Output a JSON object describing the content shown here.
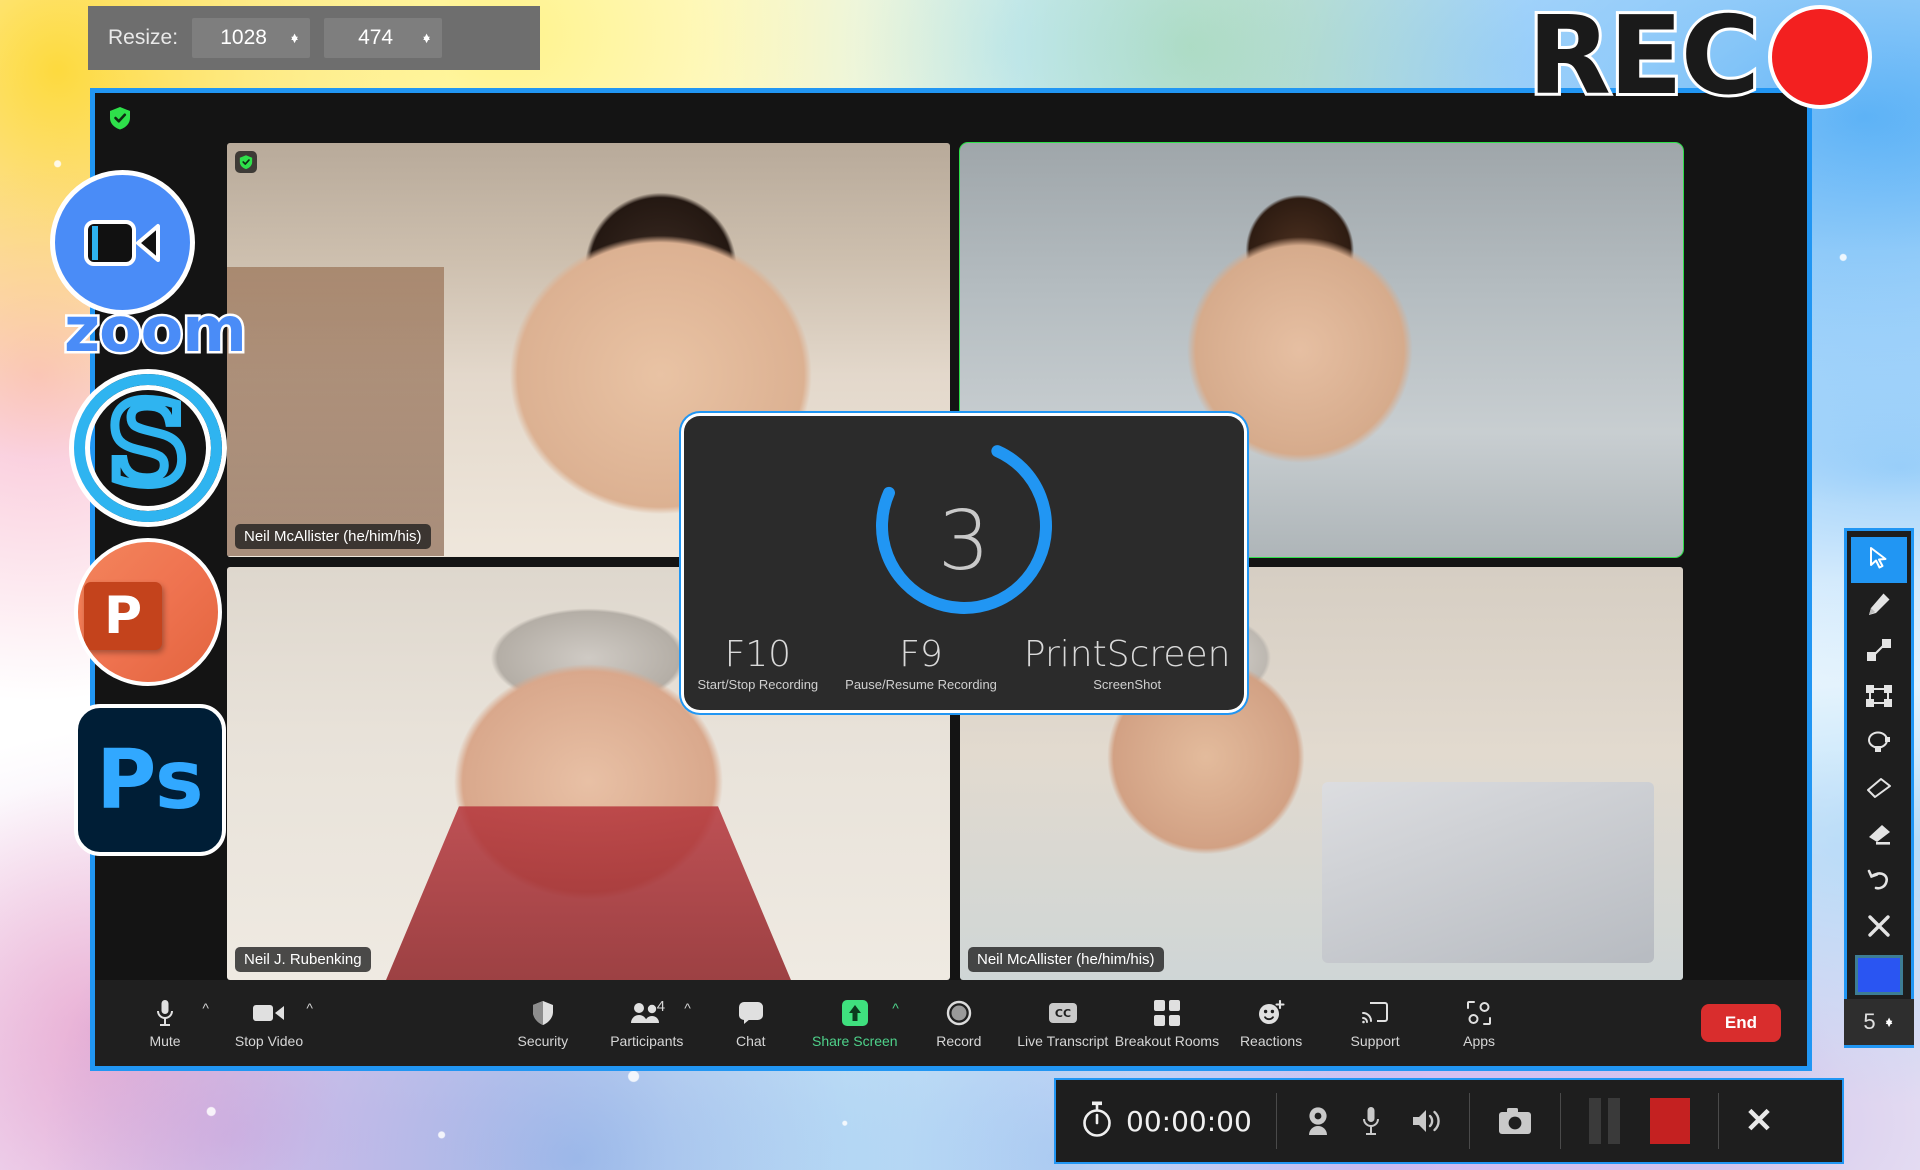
{
  "resize_bar": {
    "label": "Resize:",
    "width_value": "1028",
    "height_value": "474",
    "stepper_up": "▲",
    "stepper_down": "▼"
  },
  "rec_overlay": {
    "text": "REC",
    "dot_color": "#f32020"
  },
  "app_rail": {
    "items": [
      {
        "name": "zoom",
        "label": "zoom"
      },
      {
        "name": "skype",
        "label": "S"
      },
      {
        "name": "powerpoint",
        "label": "P"
      },
      {
        "name": "photoshop",
        "label": "Ps"
      }
    ]
  },
  "meeting": {
    "participants": [
      {
        "name": "Neil McAllister (he/him/his)",
        "active": false,
        "shield": true
      },
      {
        "name": "",
        "active": true,
        "shield": false
      },
      {
        "name": "Neil J. Rubenking",
        "active": false,
        "shield": false
      },
      {
        "name": "Neil McAllister (he/him/his)",
        "active": false,
        "shield": false
      }
    ],
    "toolbar": {
      "left": [
        {
          "id": "mute",
          "label": "Mute",
          "icon": "microphone-icon",
          "caret": true
        },
        {
          "id": "stop-video",
          "label": "Stop Video",
          "icon": "video-camera-icon",
          "caret": true
        }
      ],
      "middle": [
        {
          "id": "security",
          "label": "Security",
          "icon": "shield-icon",
          "caret": false
        },
        {
          "id": "participants",
          "label": "Participants",
          "icon": "people-icon",
          "caret": true,
          "count": "4"
        },
        {
          "id": "chat",
          "label": "Chat",
          "icon": "chat-bubble-icon",
          "caret": false
        },
        {
          "id": "share-screen",
          "label": "Share Screen",
          "icon": "share-up-arrow-icon",
          "caret": true,
          "highlight": true
        },
        {
          "id": "record",
          "label": "Record",
          "icon": "record-circle-icon",
          "caret": false
        },
        {
          "id": "live-transcript",
          "label": "Live Transcript",
          "icon": "closed-caption-icon",
          "caret": false
        },
        {
          "id": "breakout-rooms",
          "label": "Breakout Rooms",
          "icon": "grid-squares-icon",
          "caret": false
        },
        {
          "id": "reactions",
          "label": "Reactions",
          "icon": "smiley-plus-icon",
          "caret": false
        },
        {
          "id": "support",
          "label": "Support",
          "icon": "screen-cast-icon",
          "caret": false
        },
        {
          "id": "apps",
          "label": "Apps",
          "icon": "apps-icon",
          "caret": false
        }
      ],
      "end_button": "End"
    }
  },
  "countdown": {
    "number": "3",
    "hotkeys": [
      {
        "key": "F10",
        "desc": "Start/Stop Recording"
      },
      {
        "key": "F9",
        "desc": "Pause/Resume Recording"
      },
      {
        "key": "PrintScreen",
        "desc": "ScreenShot"
      }
    ],
    "ring_color": "#2196f3"
  },
  "tool_palette": {
    "tools": [
      {
        "id": "cursor",
        "icon": "cursor-arrow-icon",
        "selected": true
      },
      {
        "id": "pencil",
        "icon": "pencil-icon",
        "selected": false
      },
      {
        "id": "line",
        "icon": "line-tool-icon",
        "selected": false
      },
      {
        "id": "rectangle",
        "icon": "rectangle-tool-icon",
        "selected": false
      },
      {
        "id": "lasso",
        "icon": "lasso-tool-icon",
        "selected": false
      },
      {
        "id": "eraser",
        "icon": "eraser-icon",
        "selected": false
      },
      {
        "id": "highlighter",
        "icon": "highlighter-icon",
        "selected": false
      },
      {
        "id": "undo",
        "icon": "undo-arrow-icon",
        "selected": false
      },
      {
        "id": "clear",
        "icon": "close-x-icon",
        "selected": false
      }
    ],
    "color_value": "#2a55f2",
    "stroke_size": "5"
  },
  "recorder_bar": {
    "timer": "00:00:00",
    "buttons": [
      {
        "id": "webcam",
        "icon": "webcam-icon"
      },
      {
        "id": "microphone",
        "icon": "microphone-icon"
      },
      {
        "id": "speaker",
        "icon": "speaker-icon"
      },
      {
        "id": "screenshot",
        "icon": "camera-icon"
      },
      {
        "id": "pause",
        "icon": "pause-icon"
      },
      {
        "id": "stop",
        "icon": "stop-square-icon"
      },
      {
        "id": "close",
        "icon": "close-x-icon"
      }
    ],
    "stop_color": "#c42121"
  }
}
